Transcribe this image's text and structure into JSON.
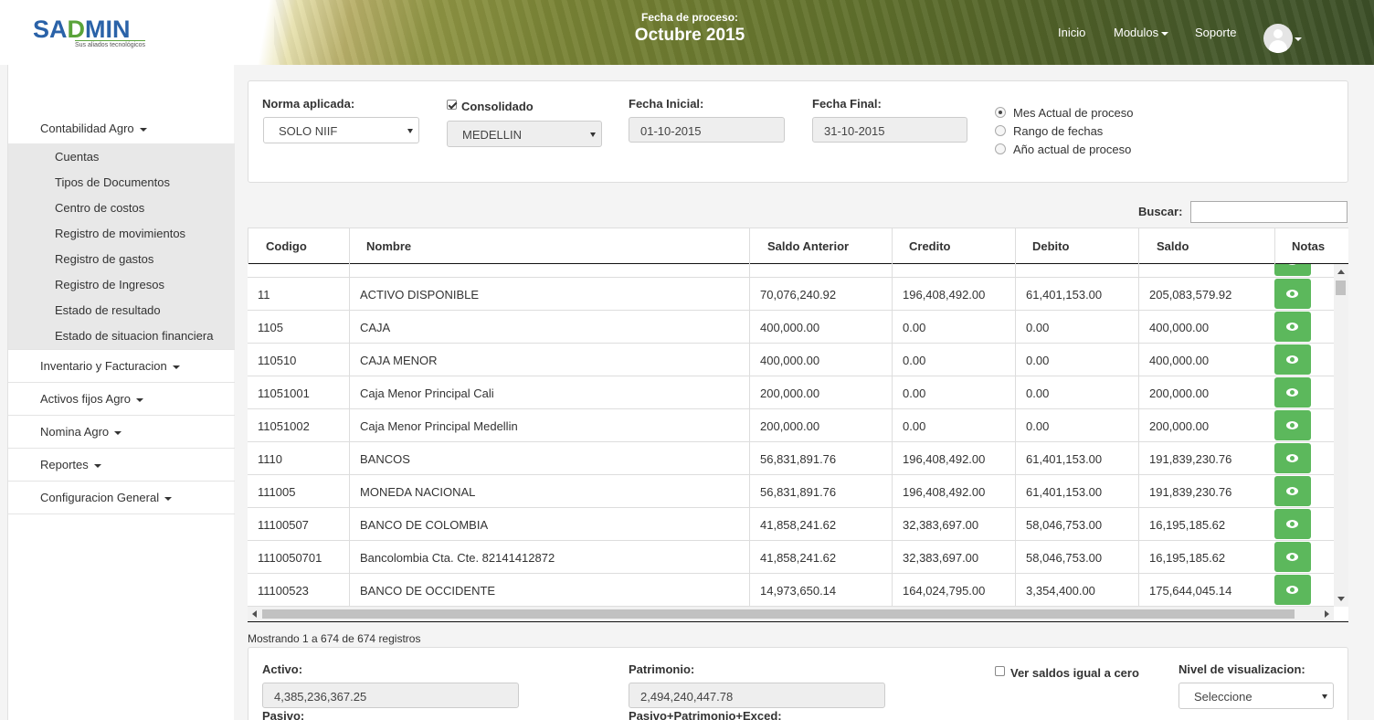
{
  "brand": {
    "name_part1": "SA",
    "name_part2": "D",
    "name_part3": "MIN",
    "tagline": "Sus aliados tecnológicos",
    "color_blue": "#2a62a8",
    "color_green": "#5aa33a"
  },
  "header": {
    "process_label": "Fecha de proceso:",
    "process_value": "Octubre 2015",
    "nav": {
      "inicio": "Inicio",
      "modulos": "Modulos",
      "soporte": "Soporte"
    }
  },
  "sidebar": {
    "groups": [
      {
        "label": "Contabilidad Agro"
      },
      {
        "label": "Inventario y Facturacion"
      },
      {
        "label": "Activos fijos Agro"
      },
      {
        "label": "Nomina Agro"
      },
      {
        "label": "Reportes"
      },
      {
        "label": "Configuracion General"
      }
    ],
    "sub_items": [
      "Cuentas",
      "Tipos de Documentos",
      "Centro de costos",
      "Registro de movimientos",
      "Registro de gastos",
      "Registro de Ingresos",
      "Estado de resultado",
      "Estado de situacion financiera"
    ]
  },
  "filters": {
    "norma_label": "Norma aplicada:",
    "norma_value": "SOLO NIIF",
    "consolidado_label": "Consolidado",
    "consolidado_checked": true,
    "sede_value": "MEDELLIN",
    "fecha_inicial_label": "Fecha Inicial:",
    "fecha_inicial_value": "01-10-2015",
    "fecha_final_label": "Fecha Final:",
    "fecha_final_value": "31-10-2015",
    "radios": [
      {
        "label": "Mes Actual de proceso",
        "checked": true
      },
      {
        "label": "Rango de fechas",
        "checked": false
      },
      {
        "label": "Año actual de proceso",
        "checked": false
      }
    ]
  },
  "search": {
    "label": "Buscar:",
    "value": ""
  },
  "table": {
    "headers": [
      "Codigo",
      "Nombre",
      "Saldo Anterior",
      "Credito",
      "Debito",
      "Saldo",
      "Notas"
    ],
    "rows": [
      [
        "11",
        "ACTIVO DISPONIBLE",
        "70,076,240.92",
        "196,408,492.00",
        "61,401,153.00",
        "205,083,579.92"
      ],
      [
        "1105",
        "CAJA",
        "400,000.00",
        "0.00",
        "0.00",
        "400,000.00"
      ],
      [
        "110510",
        "CAJA MENOR",
        "400,000.00",
        "0.00",
        "0.00",
        "400,000.00"
      ],
      [
        "11051001",
        "Caja Menor Principal Cali",
        "200,000.00",
        "0.00",
        "0.00",
        "200,000.00"
      ],
      [
        "11051002",
        "Caja Menor Principal Medellin",
        "200,000.00",
        "0.00",
        "0.00",
        "200,000.00"
      ],
      [
        "1110",
        "BANCOS",
        "56,831,891.76",
        "196,408,492.00",
        "61,401,153.00",
        "191,839,230.76"
      ],
      [
        "111005",
        "MONEDA NACIONAL",
        "56,831,891.76",
        "196,408,492.00",
        "61,401,153.00",
        "191,839,230.76"
      ],
      [
        "11100507",
        "BANCO DE COLOMBIA",
        "41,858,241.62",
        "32,383,697.00",
        "58,046,753.00",
        "16,195,185.62"
      ],
      [
        "1110050701",
        "Bancolombia Cta. Cte. 82141412872",
        "41,858,241.62",
        "32,383,697.00",
        "58,046,753.00",
        "16,195,185.62"
      ],
      [
        "11100523",
        "BANCO DE OCCIDENTE",
        "14,973,650.14",
        "164,024,795.00",
        "3,354,400.00",
        "175,644,045.14"
      ]
    ]
  },
  "footer": {
    "showing": "Mostrando 1 a 674 de 674 registros",
    "activo_label": "Activo:",
    "activo_value": "4,385,236,367.25",
    "pasivo_label": "Pasivo:",
    "patrimonio_label": "Patrimonio:",
    "patrimonio_value": "2,494,240,447.78",
    "pasivo_patrimonio_label": "Pasivo+Patrimonio+Exced:",
    "ver_saldos_label": "Ver saldos igual a cero",
    "nivel_label": "Nivel de visualizacion:",
    "nivel_value": "Seleccione"
  }
}
